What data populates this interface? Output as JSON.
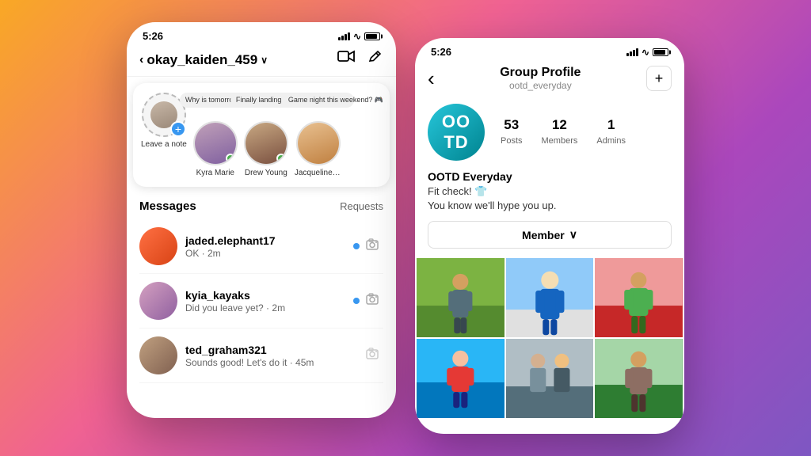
{
  "background": {
    "gradient": "linear-gradient(135deg, #f9a825, #f06292, #ab47bc, #7e57c2)"
  },
  "left_phone": {
    "status_bar": {
      "time": "5:26"
    },
    "nav": {
      "username": "okay_kaiden_459",
      "chevron": "∨",
      "video_icon": "▭",
      "edit_icon": "✏"
    },
    "stories": {
      "add_note_label": "Leave a note",
      "items": [
        {
          "name": "Kyra Marie",
          "note": "Why is tomorrow Monday!? 😅",
          "online": true
        },
        {
          "name": "Drew Young",
          "note": "Finally landing in NYC! ❤️",
          "online": true
        },
        {
          "name": "Jacqueline Lam",
          "note": "Game night this weekend? 🎮",
          "online": false
        }
      ]
    },
    "messages": {
      "section_title": "Messages",
      "requests_label": "Requests",
      "items": [
        {
          "username": "jaded.elephant17",
          "preview": "OK · 2m",
          "unread": true
        },
        {
          "username": "kyia_kayaks",
          "preview": "Did you leave yet? · 2m",
          "unread": true
        },
        {
          "username": "ted_graham321",
          "preview": "Sounds good! Let's do it · 45m",
          "unread": false
        }
      ]
    }
  },
  "right_phone": {
    "status_bar": {
      "time": "5:26"
    },
    "nav": {
      "back_icon": "‹",
      "title": "Group Profile",
      "subtitle": "ootd_everyday",
      "add_icon": "+"
    },
    "group": {
      "avatar_text": "OO\nTD",
      "stats": [
        {
          "number": "53",
          "label": "Posts"
        },
        {
          "number": "12",
          "label": "Members"
        },
        {
          "number": "1",
          "label": "Admins"
        }
      ],
      "name": "OOTD Everyday",
      "description_line1": "Fit check! 👕",
      "description_line2": "You know we'll hype you up.",
      "member_button": "Member",
      "chevron": "∨"
    },
    "photos": [
      {
        "id": 1,
        "class": "photo-1"
      },
      {
        "id": 2,
        "class": "photo-2"
      },
      {
        "id": 3,
        "class": "photo-3"
      },
      {
        "id": 4,
        "class": "photo-4"
      },
      {
        "id": 5,
        "class": "photo-5"
      },
      {
        "id": 6,
        "class": "photo-6"
      }
    ]
  }
}
